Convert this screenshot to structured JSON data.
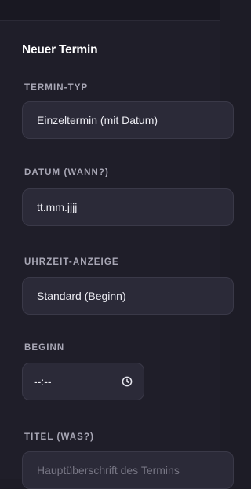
{
  "form": {
    "title": "Neuer Termin",
    "fields": [
      {
        "label": "TERMIN-TYP",
        "value": "Einzeltermin (mit Datum)"
      },
      {
        "label": "DATUM (WANN?)",
        "value": "tt.mm.jjjj"
      },
      {
        "label": "UHRZEIT-ANZEIGE",
        "value": "Standard (Beginn)"
      },
      {
        "label": "BEGINN",
        "value": "--:--",
        "icon": "clock-icon"
      },
      {
        "label": "TITEL (WAS?)",
        "placeholder": "Hauptüberschrift des Termins"
      }
    ]
  }
}
